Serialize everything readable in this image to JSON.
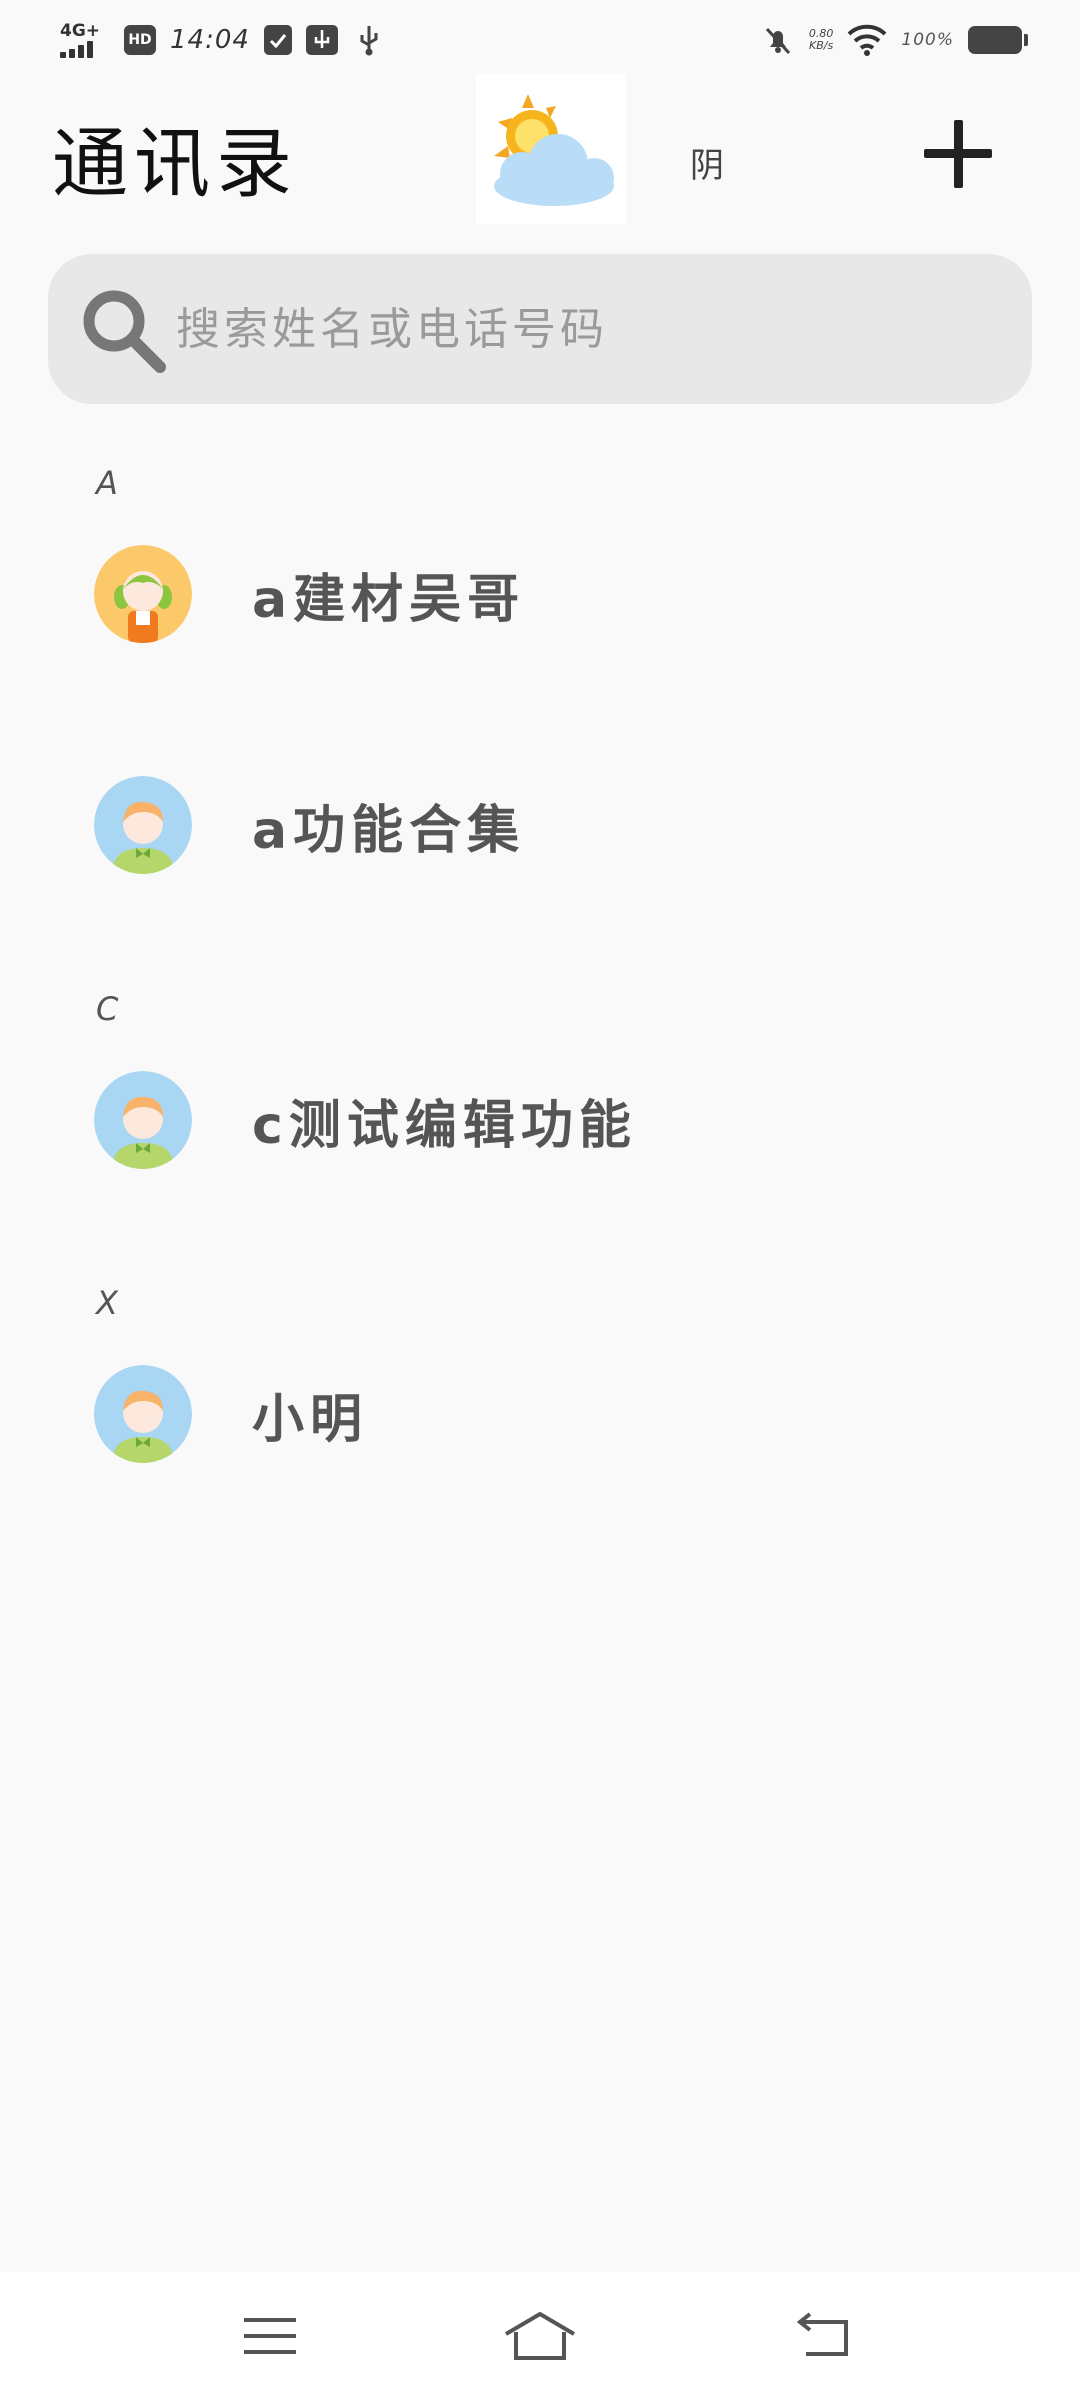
{
  "status_bar": {
    "network": "4G+",
    "hd": "HD",
    "time": "14:04",
    "speed_value": "0.80",
    "speed_unit": "KB/s",
    "battery": "100%"
  },
  "header": {
    "title": "通讯录",
    "weather_text": "阴",
    "weather_icon": "sun-cloud-icon",
    "add_icon": "plus-icon"
  },
  "search": {
    "placeholder": "搜索姓名或电话号码",
    "value": ""
  },
  "sections": [
    {
      "letter": "A",
      "contacts": [
        {
          "name": "a建材吴哥",
          "avatar": "girl-avatar"
        },
        {
          "name": "a功能合集",
          "avatar": "boy-avatar"
        }
      ]
    },
    {
      "letter": "C",
      "contacts": [
        {
          "name": "c测试编辑功能",
          "avatar": "boy-avatar"
        }
      ]
    },
    {
      "letter": "X",
      "contacts": [
        {
          "name": "小明",
          "avatar": "boy-avatar"
        }
      ]
    }
  ],
  "nav": {
    "menu_icon": "menu-icon",
    "home_icon": "home-icon",
    "back_icon": "back-icon"
  }
}
